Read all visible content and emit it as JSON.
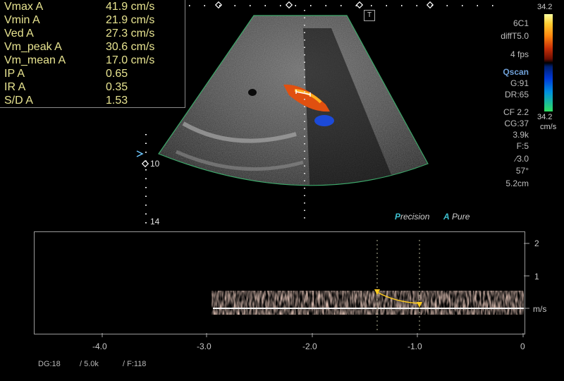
{
  "measurements": [
    {
      "label": "Vmax  A",
      "value": "41.9 cm/s"
    },
    {
      "label": "Vmin  A",
      "value": "21.9 cm/s"
    },
    {
      "label": "Ved  A",
      "value": "27.3 cm/s"
    },
    {
      "label": "Vm_peak  A",
      "value": "30.6 cm/s"
    },
    {
      "label": "Vm_mean  A",
      "value": "17.0 cm/s"
    },
    {
      "label": "IP  A",
      "value": "0.65"
    },
    {
      "label": "IR  A",
      "value": "0.35"
    },
    {
      "label": "S/D  A",
      "value": "1.53"
    }
  ],
  "params": [
    "6C1",
    "diffT5.0",
    "4 fps",
    "Qscan",
    "G:91",
    "DR:65",
    "CF 2.2",
    "CG:37",
    "3.9k",
    "F:5",
    "∕3.0",
    "57°",
    "5.2cm"
  ],
  "colorbar": {
    "top": "34.2",
    "bottom": "34.2",
    "unit": "cm/s"
  },
  "depth_labels": [
    "10",
    "14"
  ],
  "presets": {
    "p1_letter": "P",
    "p1_rest": "recision",
    "p2_letter": "A",
    "p2_rest": "Pure"
  },
  "velocity_axis": {
    "ticks": [
      "2",
      "1"
    ],
    "unit": "m/s"
  },
  "time_axis": {
    "ticks": [
      "-4.0",
      "-3.0",
      "-2.0",
      "-1.0",
      "0"
    ]
  },
  "bottom_status": {
    "dg": "DG:18",
    "scale": "/ 5.0k",
    "frame": "/ F:118"
  },
  "top_icon": "T"
}
